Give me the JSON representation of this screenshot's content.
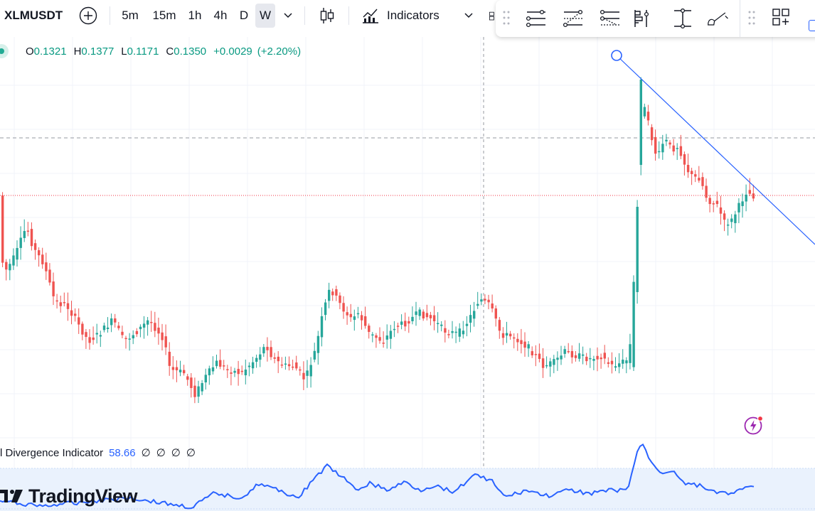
{
  "toolbar": {
    "symbol": "XLMUSDT",
    "timeframes": [
      "5m",
      "15m",
      "1h",
      "4h",
      "D",
      "W"
    ],
    "active_timeframe": "W",
    "indicators_label": "Indicators"
  },
  "legend": {
    "open_key": "O",
    "open": "0.1321",
    "high_key": "H",
    "high": "0.1377",
    "low_key": "L",
    "low": "0.1171",
    "close_key": "C",
    "close": "0.1350",
    "change": "+0.0029",
    "change_pct": "(+2.20%)"
  },
  "indicator": {
    "name": "l Divergence Indicator",
    "value": "58.66",
    "placeholders": [
      "∅",
      "∅",
      "∅",
      "∅"
    ]
  },
  "brand": {
    "name": "TradingView"
  },
  "colors": {
    "up": "#26a69a",
    "down": "#ef5350",
    "trendline": "#2962ff",
    "indicator_line": "#2962ff",
    "indicator_band": "#eaf2fd",
    "last_price_line": "#f23645",
    "active_button_bg": "#e6e8ee"
  },
  "icons": [
    "add-symbol-icon",
    "candle-type-icon",
    "indicators-icon",
    "chevron-down-icon",
    "drag-handle-icon",
    "horizontal-lines-icon",
    "fib-retracement-icon",
    "fib-extension-icon",
    "long-position-icon",
    "price-range-icon",
    "brush-icon",
    "layout-icon",
    "lightning-icon",
    "tradingview-logo-icon"
  ]
}
